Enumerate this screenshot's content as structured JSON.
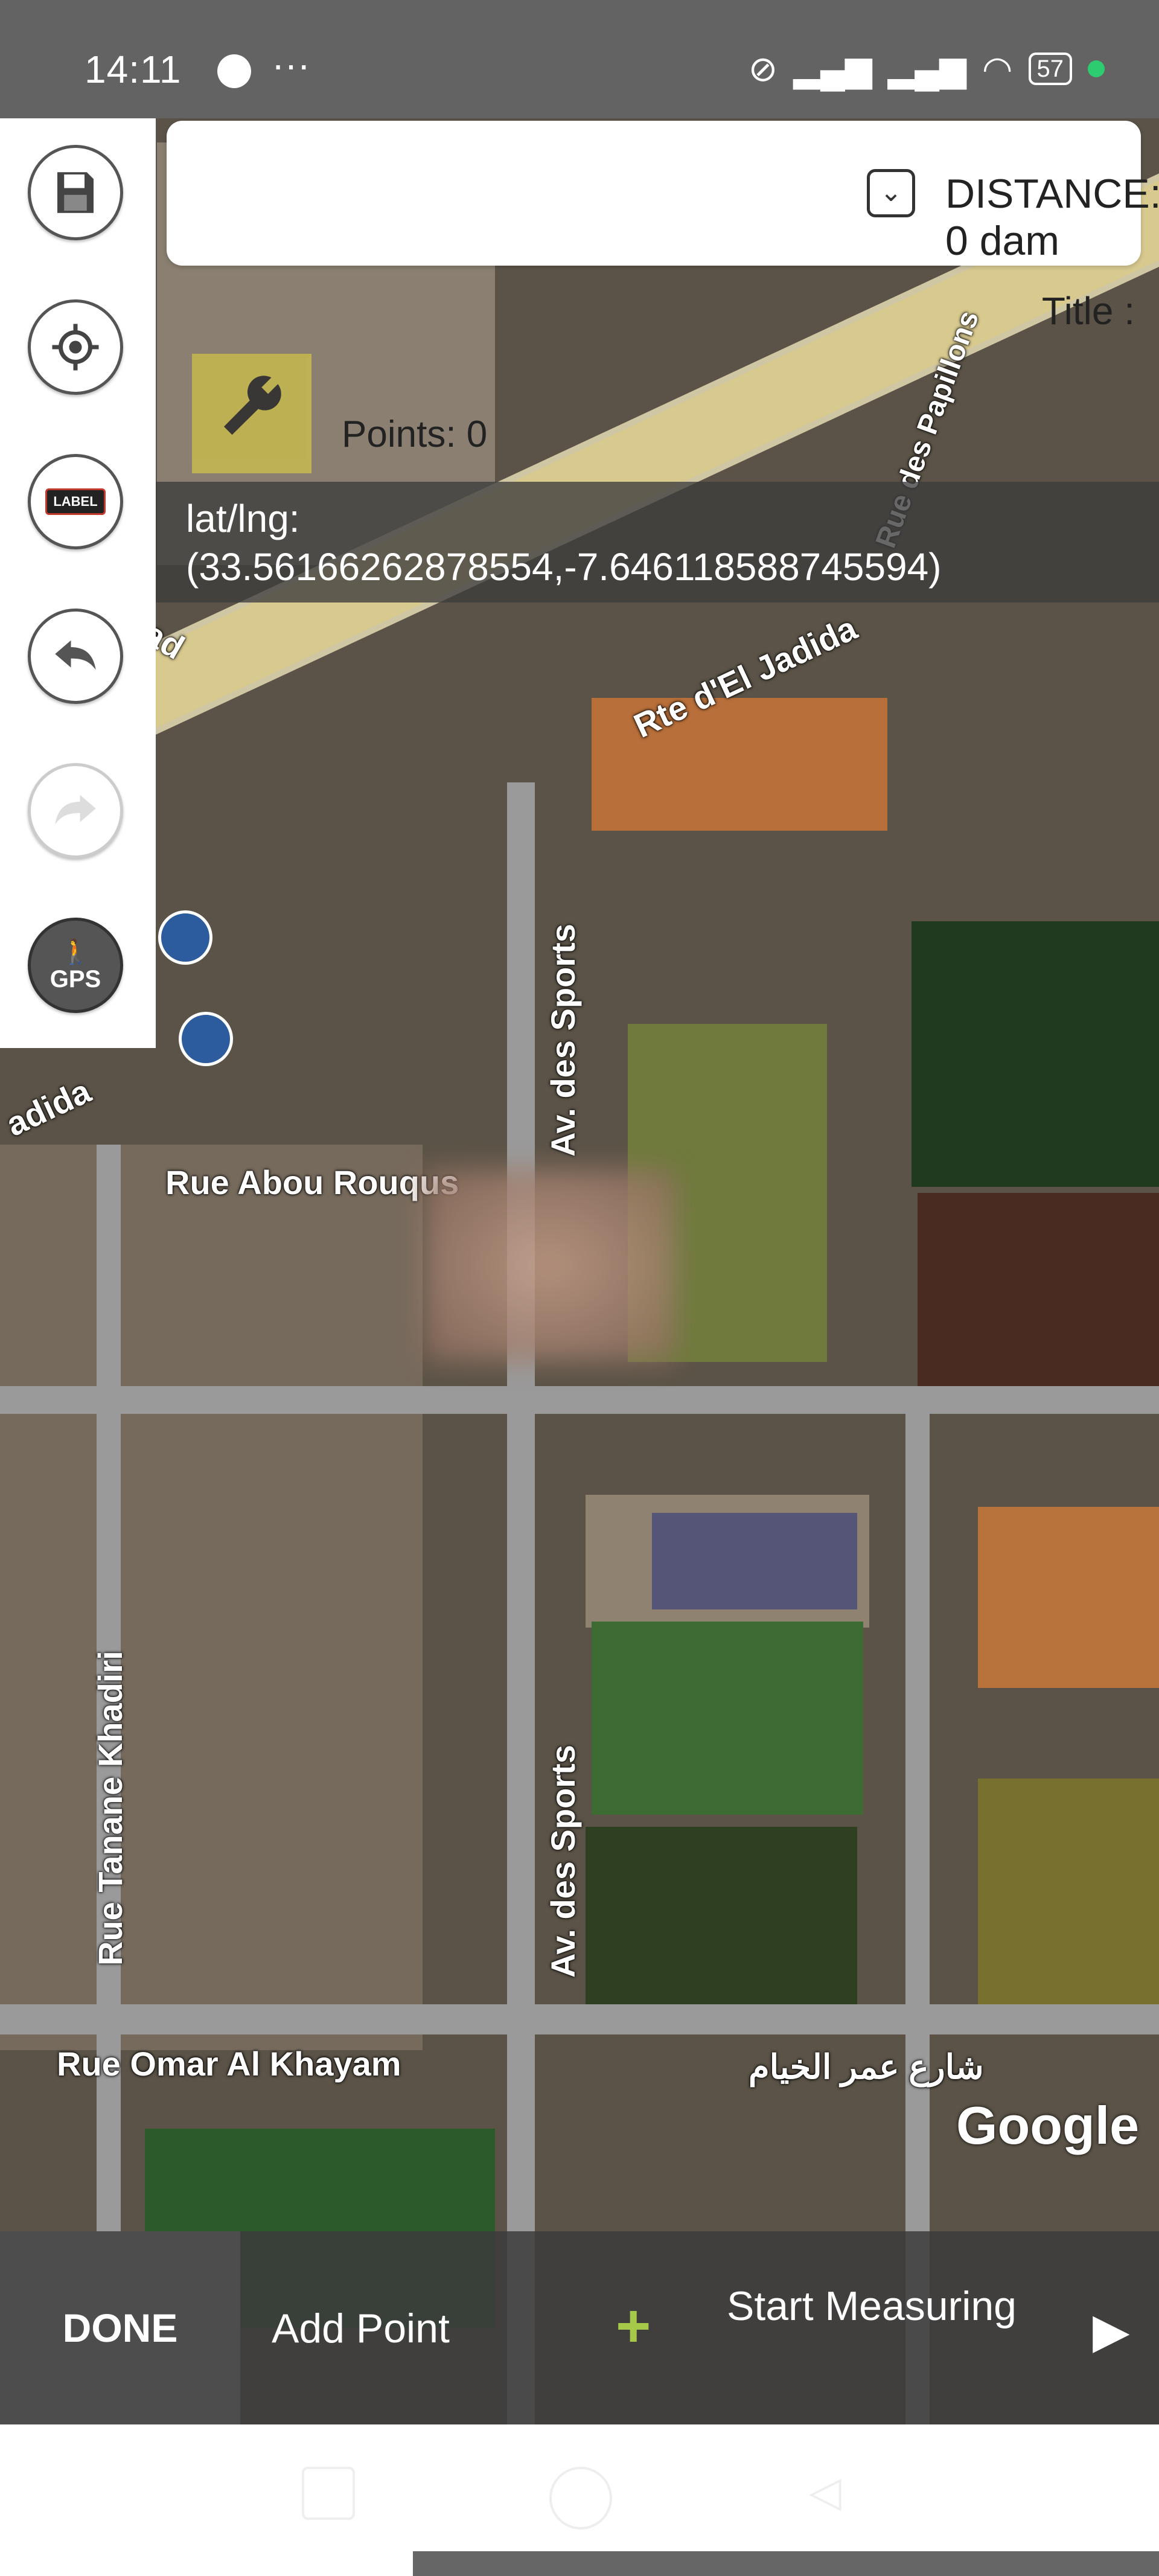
{
  "status_bar": {
    "time": "14:11",
    "messenger_icon": "messenger-icon",
    "more": "···",
    "battery": "57",
    "icons": [
      "mute-icon",
      "signal-icon",
      "signal-icon",
      "wifi-icon",
      "battery-icon",
      "green-dot"
    ]
  },
  "top_panel": {
    "distance_label": "DISTANCE: 0 dam",
    "dropdown_icon": "chevron-down-icon",
    "title_label": "Title :"
  },
  "toolbar": {
    "buttons": [
      "save-icon",
      "locate-icon",
      "label-icon",
      "undo-icon",
      "redo-icon",
      "gps-walk-icon"
    ],
    "label_text": "LABEL",
    "gps_text": "GPS"
  },
  "info": {
    "points": "Points: 0",
    "latlng_label": "lat/lng:",
    "latlng_value": "(33.56166262878554,-7.646118588745594)"
  },
  "map": {
    "streets": [
      "Rte d'El Jadida",
      "adida",
      "Av. des Sports",
      "Av. des Sports",
      "Rue Abou Rouqus",
      "Rue Tanane Khadiri",
      "Rue Omar Al Khayam",
      "شارع عمر الخيام",
      "Rue des Papillons",
      "ad"
    ],
    "attribution": "Google"
  },
  "bottom_bar": {
    "done": "DONE",
    "add_point": "Add Point",
    "start_measuring": "Start Measuring",
    "accent": "#a6c94a"
  }
}
